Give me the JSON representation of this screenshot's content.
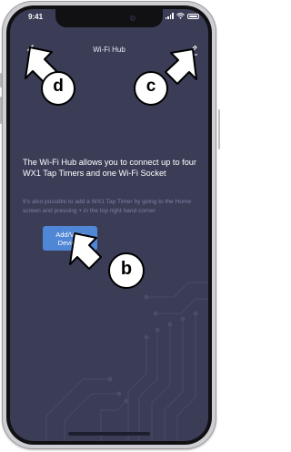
{
  "status_bar": {
    "time": "9:41"
  },
  "nav": {
    "title": "Wi-Fi Hub",
    "back_icon": "chevron-left-icon",
    "edit_icon": "pencil-icon"
  },
  "content": {
    "main_text": "The Wi-Fi Hub allows you to connect up to four WX1 Tap Timers and one Wi-Fi Socket",
    "sub_text": "It's also possible to add a WX1 Tap Timer by going to the Home screen and pressing + in the top right hand corner",
    "button": {
      "line1": "Add/View",
      "line2": "Devices"
    }
  },
  "callouts": {
    "d": "d",
    "c": "c",
    "b": "b"
  },
  "colors": {
    "screen_bg": "#3b3d57",
    "button_bg": "#4f86d6",
    "sub_text": "#7d80a1"
  }
}
